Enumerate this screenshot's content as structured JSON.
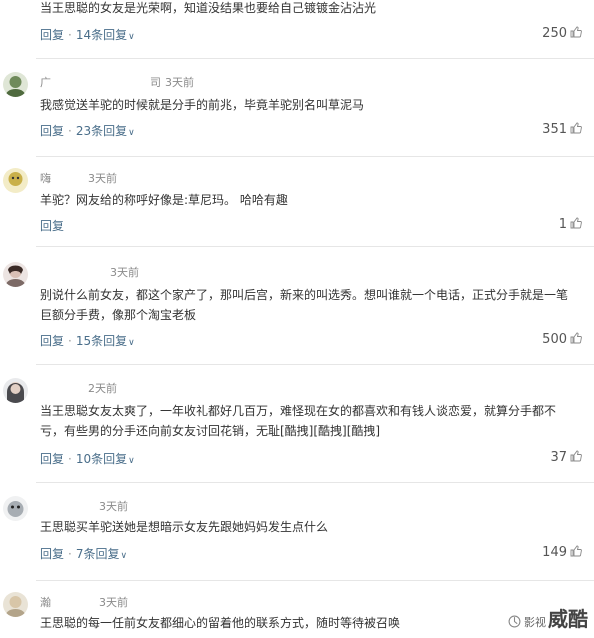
{
  "comments": [
    {
      "user": "",
      "time": "",
      "text1": "当王思聪的女友是光荣啊，知道没结果也要给自己镀镀金沾沾光",
      "text2": "",
      "reply_label": "回复",
      "replies": "14条回复",
      "likes": "250",
      "avatar_color": "#9aa7b0"
    },
    {
      "user": "广　　　　　　　　　司",
      "time": "3天前",
      "text1": "我感觉送羊驼的时候就是分手的前兆，毕竟羊驼别名叫草泥马",
      "text2": "",
      "reply_label": "回复",
      "replies": "23条回复",
      "likes": "351",
      "avatar_color": "#6f8a5a"
    },
    {
      "user": "嗨　　　",
      "time": "3天前",
      "text1": "羊驼？网友给的称呼好像是:草尼玛。 哈哈有趣",
      "text2": "",
      "reply_label": "回复",
      "replies": "",
      "likes": "1",
      "avatar_color": "#c9b04a"
    },
    {
      "user": "　　　　　　",
      "time": "3天前",
      "text1": "别说什么前女友，都这个家产了，那叫后宫，新来的叫选秀。想叫谁就一个电话，正式分手就是一笔",
      "text2": "巨额分手费，像那个淘宝老板",
      "reply_label": "回复",
      "replies": "15条回复",
      "likes": "500",
      "avatar_color": "#7c6a66"
    },
    {
      "user": "　　　　",
      "time": "2天前",
      "text1": "当王思聪女友太爽了，一年收礼都好几百万，难怪现在女的都喜欢和有钱人谈恋爱，就算分手都不",
      "text2": "亏，有些男的分手还向前女友讨回花销，无耻[酷拽][酷拽][酷拽]",
      "reply_label": "回复",
      "replies": "10条回复",
      "likes": "37",
      "avatar_color": "#8c8f96"
    },
    {
      "user": "　　　　　",
      "time": "3天前",
      "text1": "王思聪买羊驼送她是想暗示女友先跟她妈妈发生点什么",
      "text2": "",
      "reply_label": "回复",
      "replies": "7条回复",
      "likes": "149",
      "avatar_color": "#a7adb3"
    },
    {
      "user": "瀚　　　　",
      "time": "3天前",
      "text1": "王思聪的每一任前女友都细心的留着他的联系方式，随时等待被召唤",
      "text2": "",
      "reply_label": "",
      "replies": "",
      "likes": "",
      "avatar_color": "#b3a48a"
    }
  ],
  "watermark": {
    "small": "影视",
    "big": "威酷"
  },
  "colors": {
    "link": "#4a6e8a",
    "text": "#333333",
    "muted": "#8a8a8a",
    "divider": "#e6e6e6"
  },
  "icons": {
    "like": "thumb-up-icon",
    "expand": "chevron-down-icon"
  }
}
